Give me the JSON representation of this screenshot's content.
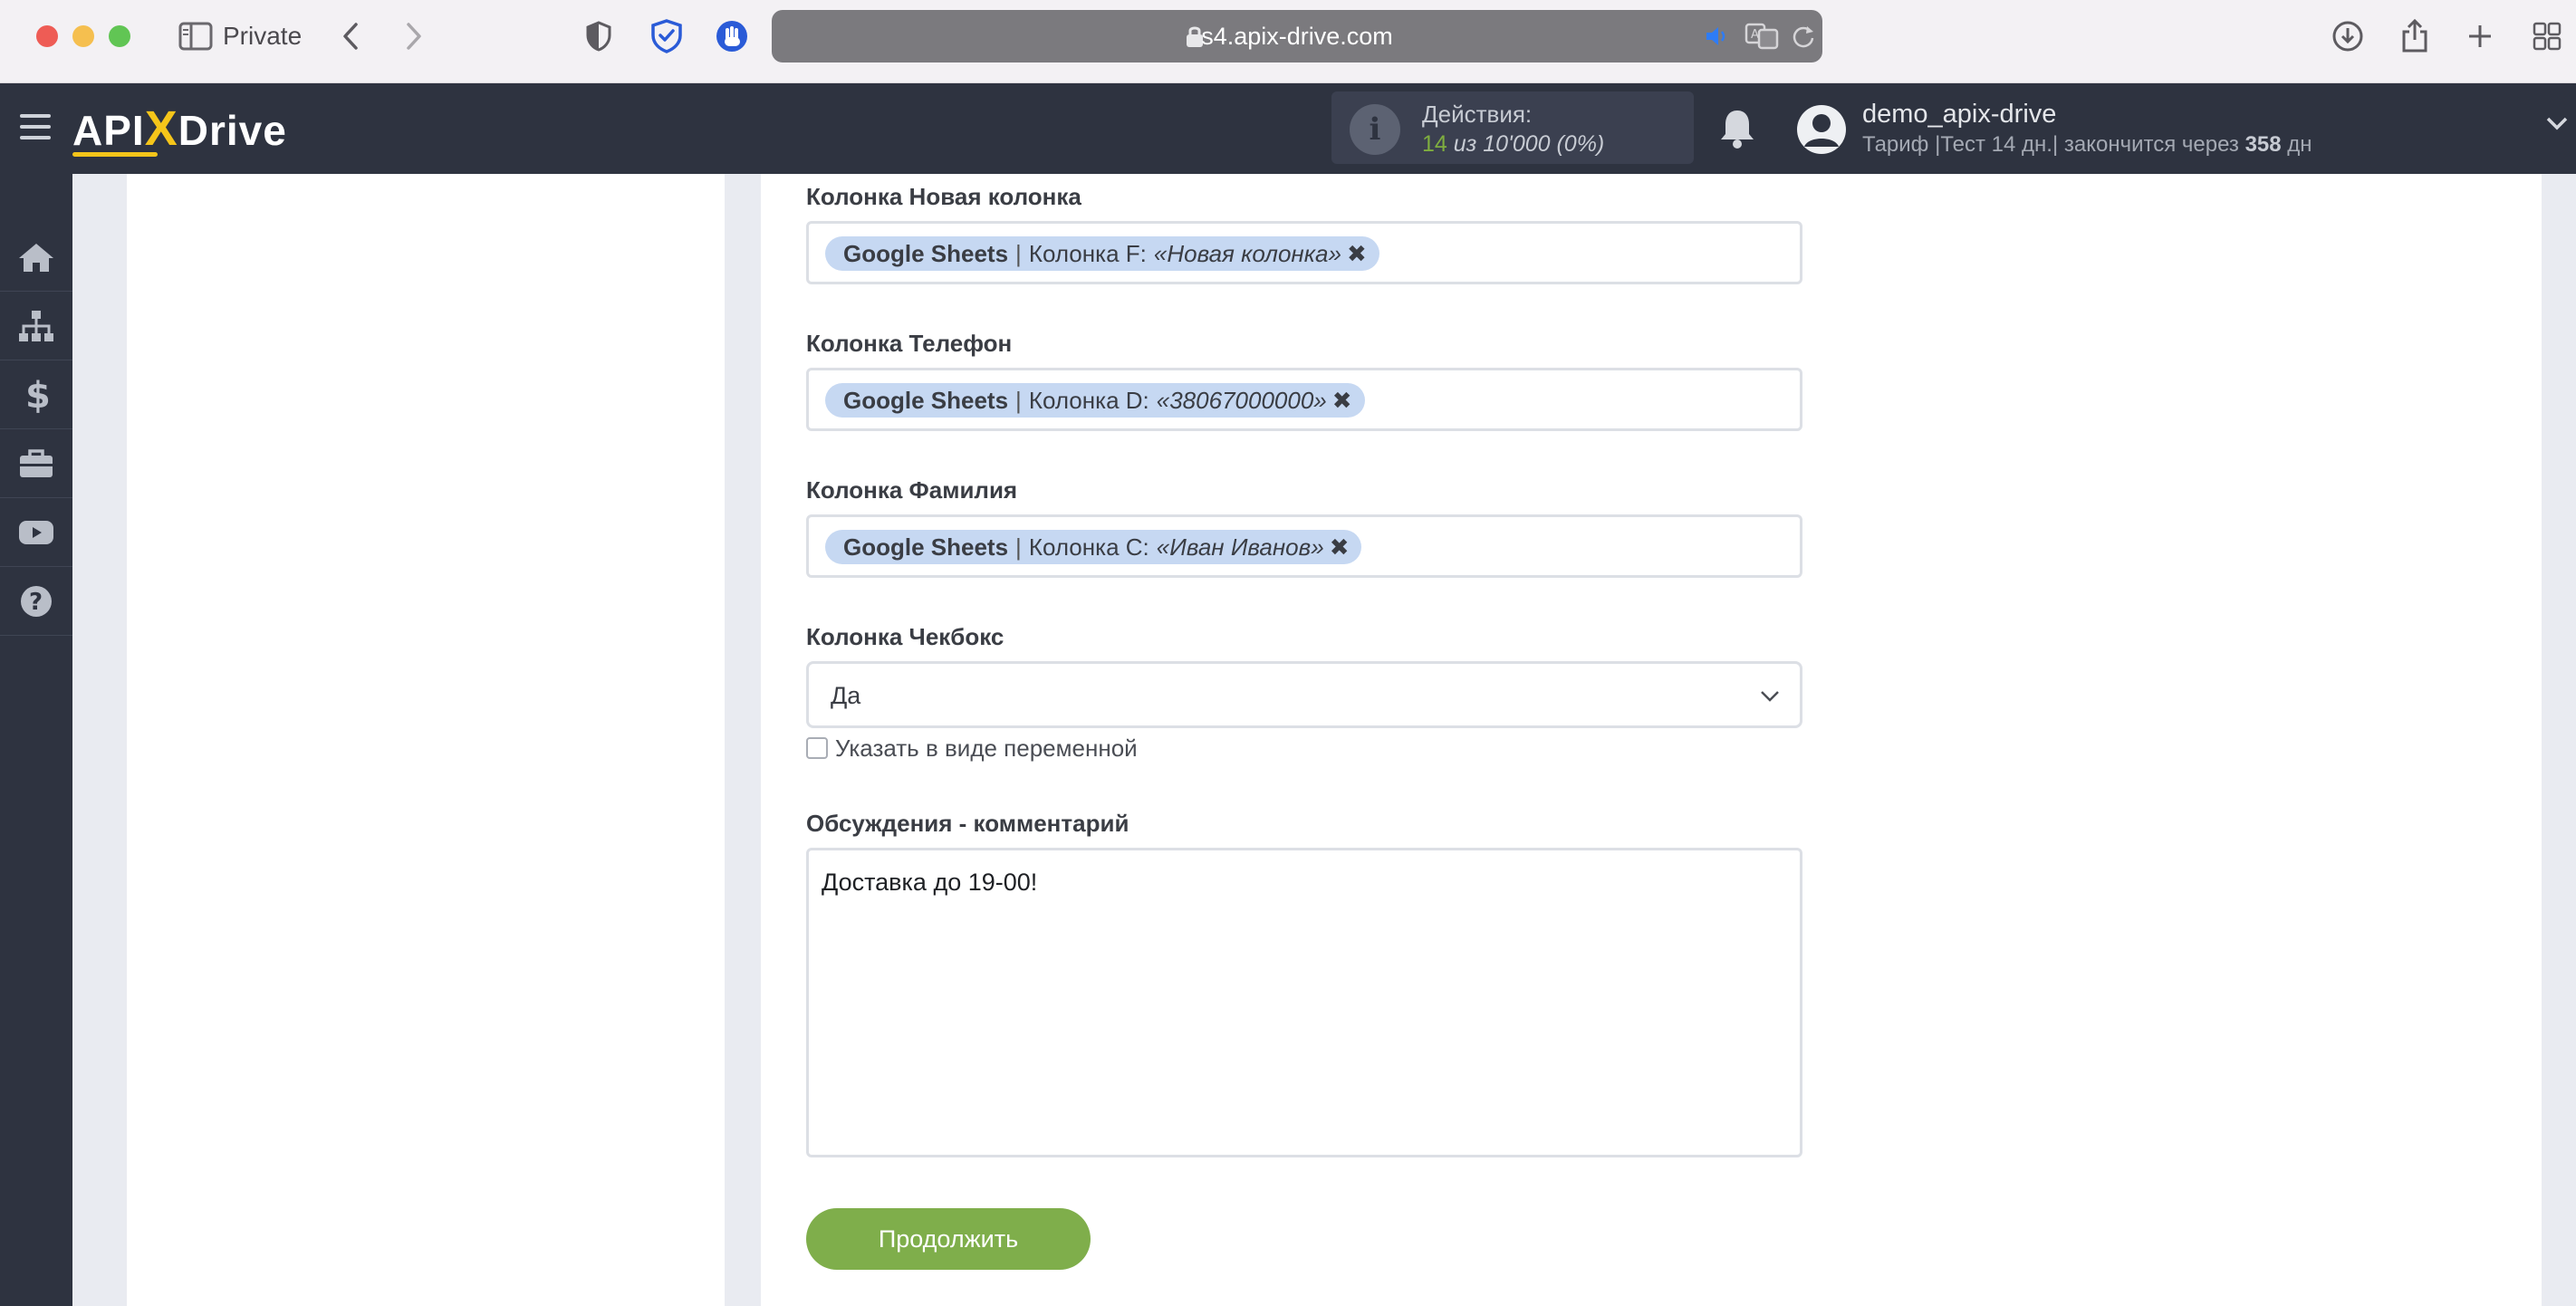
{
  "browser": {
    "private_label": "Private",
    "url": "s4.apix-drive.com"
  },
  "header": {
    "logo_api": "API",
    "logo_x": "X",
    "logo_drive": "Drive",
    "actions_title": "Действия:",
    "actions_count": "14",
    "actions_rest": "из 10'000 (0%)",
    "user_name": "demo_apix-drive",
    "plan_prefix": "Тариф |Тест 14 дн.| закончится через",
    "plan_days": "358",
    "plan_suffix": "дн"
  },
  "nav": {
    "icons": [
      "home-icon",
      "sitemap-icon",
      "dollar-icon",
      "briefcase-icon",
      "youtube-icon",
      "help-icon"
    ]
  },
  "form": {
    "fields": [
      {
        "label": "Колонка Новая колонка",
        "tag_source": "Google Sheets",
        "tag_column": "Колонка F:",
        "tag_sample": "«Новая колонка»"
      },
      {
        "label": "Колонка Телефон",
        "tag_source": "Google Sheets",
        "tag_column": "Колонка D:",
        "tag_sample": "«38067000000»"
      },
      {
        "label": "Колонка Фамилия",
        "tag_source": "Google Sheets",
        "tag_column": "Колонка C:",
        "tag_sample": "«Иван Иванов»"
      }
    ],
    "checkbox_field": {
      "label": "Колонка Чекбокс",
      "selected": "Да",
      "variable_label": "Указать в виде переменной"
    },
    "comment": {
      "label": "Обсуждения - комментарий",
      "value": "Доставка до 19-00!"
    },
    "continue_label": "Продолжить"
  },
  "colors": {
    "header_bg": "#2e3340",
    "accent_yellow": "#f5c51a",
    "tag_bg": "#c6d8f2",
    "button_green": "#7fae4b"
  }
}
